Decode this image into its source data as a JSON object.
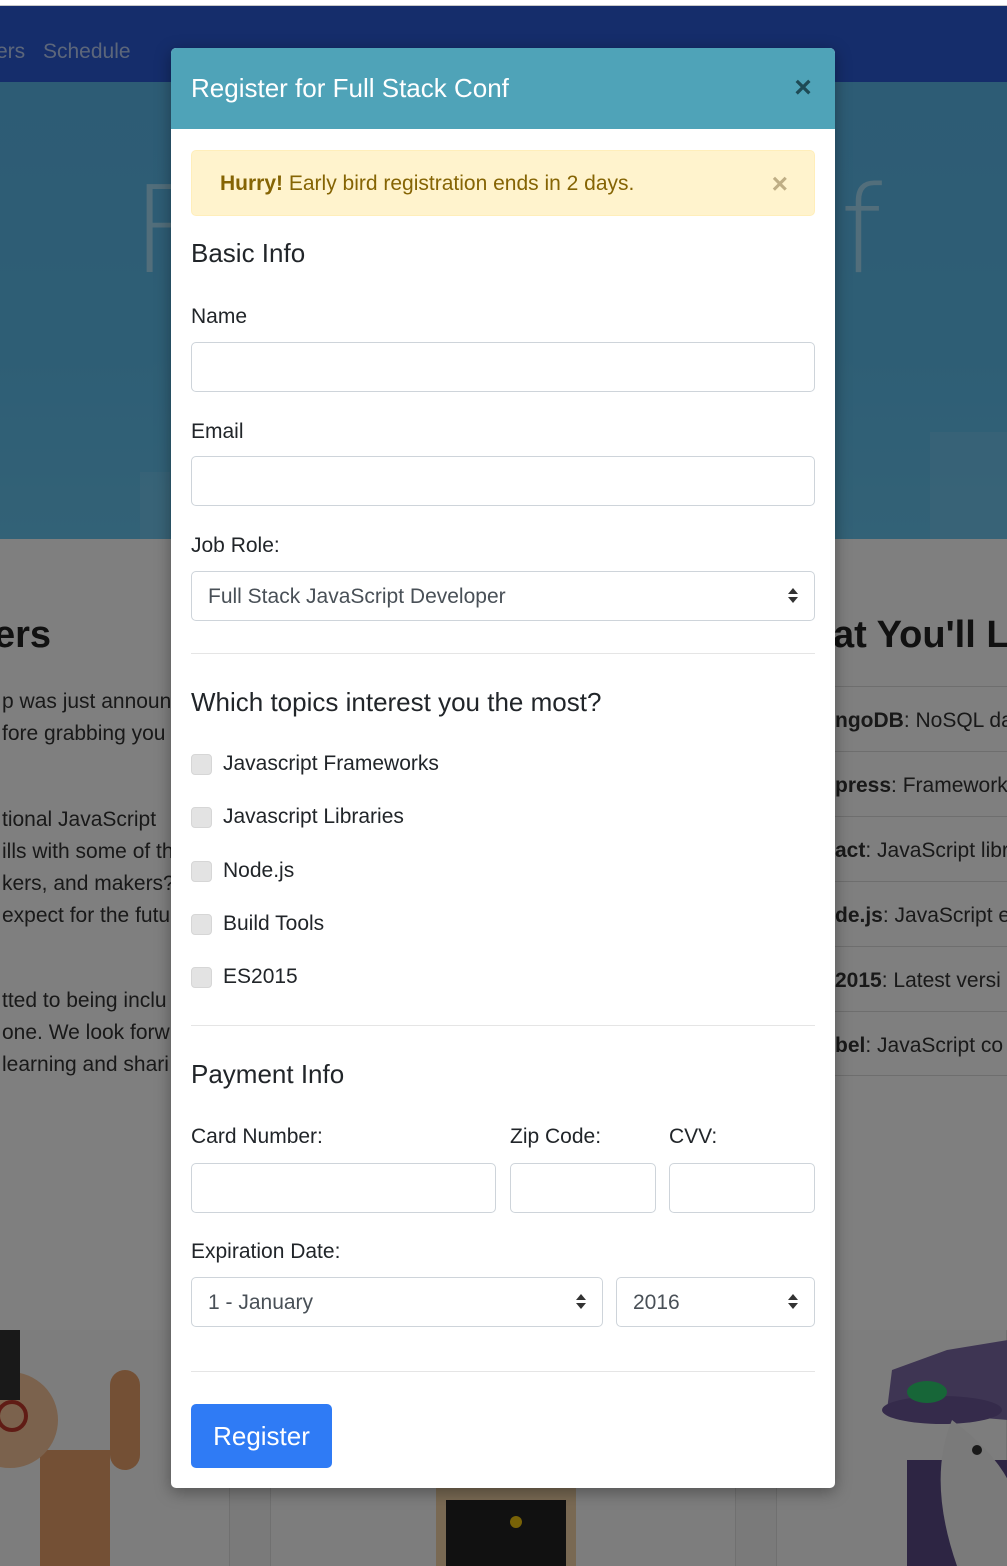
{
  "background": {
    "nav": {
      "partial_link": "ers",
      "schedule": "Schedule"
    },
    "hero": {
      "left_letter": "F",
      "right_letter": "f"
    },
    "left_section": {
      "title": "ers",
      "lines": [
        "p was just announ",
        "fore grabbing you",
        "tional JavaScript",
        "ills with some of th",
        "kers, and makers?",
        " expect for the futu",
        "tted to being inclu",
        "one. We look forw",
        "learning and shari"
      ]
    },
    "right_section": {
      "title": "at You'll Le",
      "items": [
        {
          "name": "ngoDB",
          "desc": ": NoSQL da"
        },
        {
          "name": "press",
          "desc": ": Framework"
        },
        {
          "name": "act",
          "desc": ": JavaScript libr"
        },
        {
          "name": "de.js",
          "desc": ": JavaScript e"
        },
        {
          "name": "2015",
          "desc": ": Latest versi"
        },
        {
          "name": "bel",
          "desc": ": JavaScript co"
        }
      ]
    }
  },
  "modal": {
    "title": "Register for Full Stack Conf",
    "close_icon": "×",
    "alert": {
      "strong": "Hurry!",
      "text": " Early bird registration ends in 2 days.",
      "close_icon": "×"
    },
    "basic_info": {
      "heading": "Basic Info",
      "name_label": "Name",
      "name_value": "",
      "email_label": "Email",
      "email_value": "",
      "job_role_label": "Job Role:",
      "job_role_value": "Full Stack JavaScript Developer"
    },
    "topics": {
      "heading": "Which topics interest you the most?",
      "items": [
        {
          "label": "Javascript Frameworks",
          "checked": false
        },
        {
          "label": "Javascript Libraries",
          "checked": false
        },
        {
          "label": "Node.js",
          "checked": false
        },
        {
          "label": "Build Tools",
          "checked": false
        },
        {
          "label": "ES2015",
          "checked": false
        }
      ]
    },
    "payment": {
      "heading": "Payment Info",
      "card_label": "Card Number:",
      "zip_label": "Zip Code:",
      "cvv_label": "CVV:",
      "expiration_label": "Expiration Date:",
      "month_value": "1 - January",
      "year_value": "2016"
    },
    "submit_label": "Register"
  },
  "colors": {
    "header": "#4fa3b8",
    "alert_bg": "#fff3cd",
    "alert_text": "#856404",
    "primary_button": "#2f7bf5",
    "navbar": "#2a5bd7"
  }
}
